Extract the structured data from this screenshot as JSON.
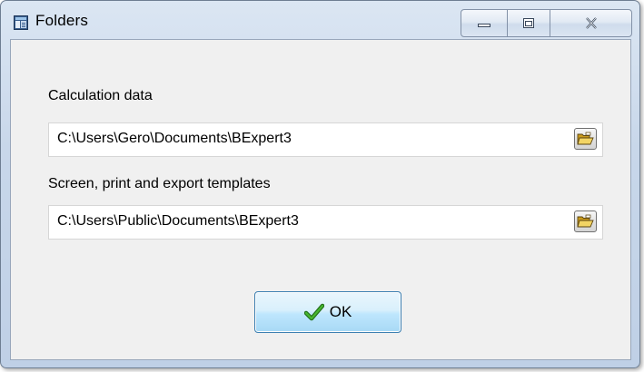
{
  "window": {
    "title": "Folders",
    "controls": {
      "minimize_icon": "minimize-icon",
      "maximize_icon": "maximize-icon",
      "close_icon": "close-icon"
    }
  },
  "fields": {
    "calculation": {
      "label": "Calculation data",
      "value": "C:\\Users\\Gero\\Documents\\BExpert3",
      "button_icon": "open-folder-icon"
    },
    "templates": {
      "label": "Screen, print and export templates",
      "value": "C:\\Users\\Public\\Documents\\BExpert3",
      "button_icon": "open-folder-icon"
    }
  },
  "buttons": {
    "ok_label": "OK",
    "ok_icon": "checkmark-icon"
  },
  "colors": {
    "check_green": "#2f8f1f",
    "folder_yellow": "#e8c23a",
    "ok_border": "#3c7fb1"
  }
}
